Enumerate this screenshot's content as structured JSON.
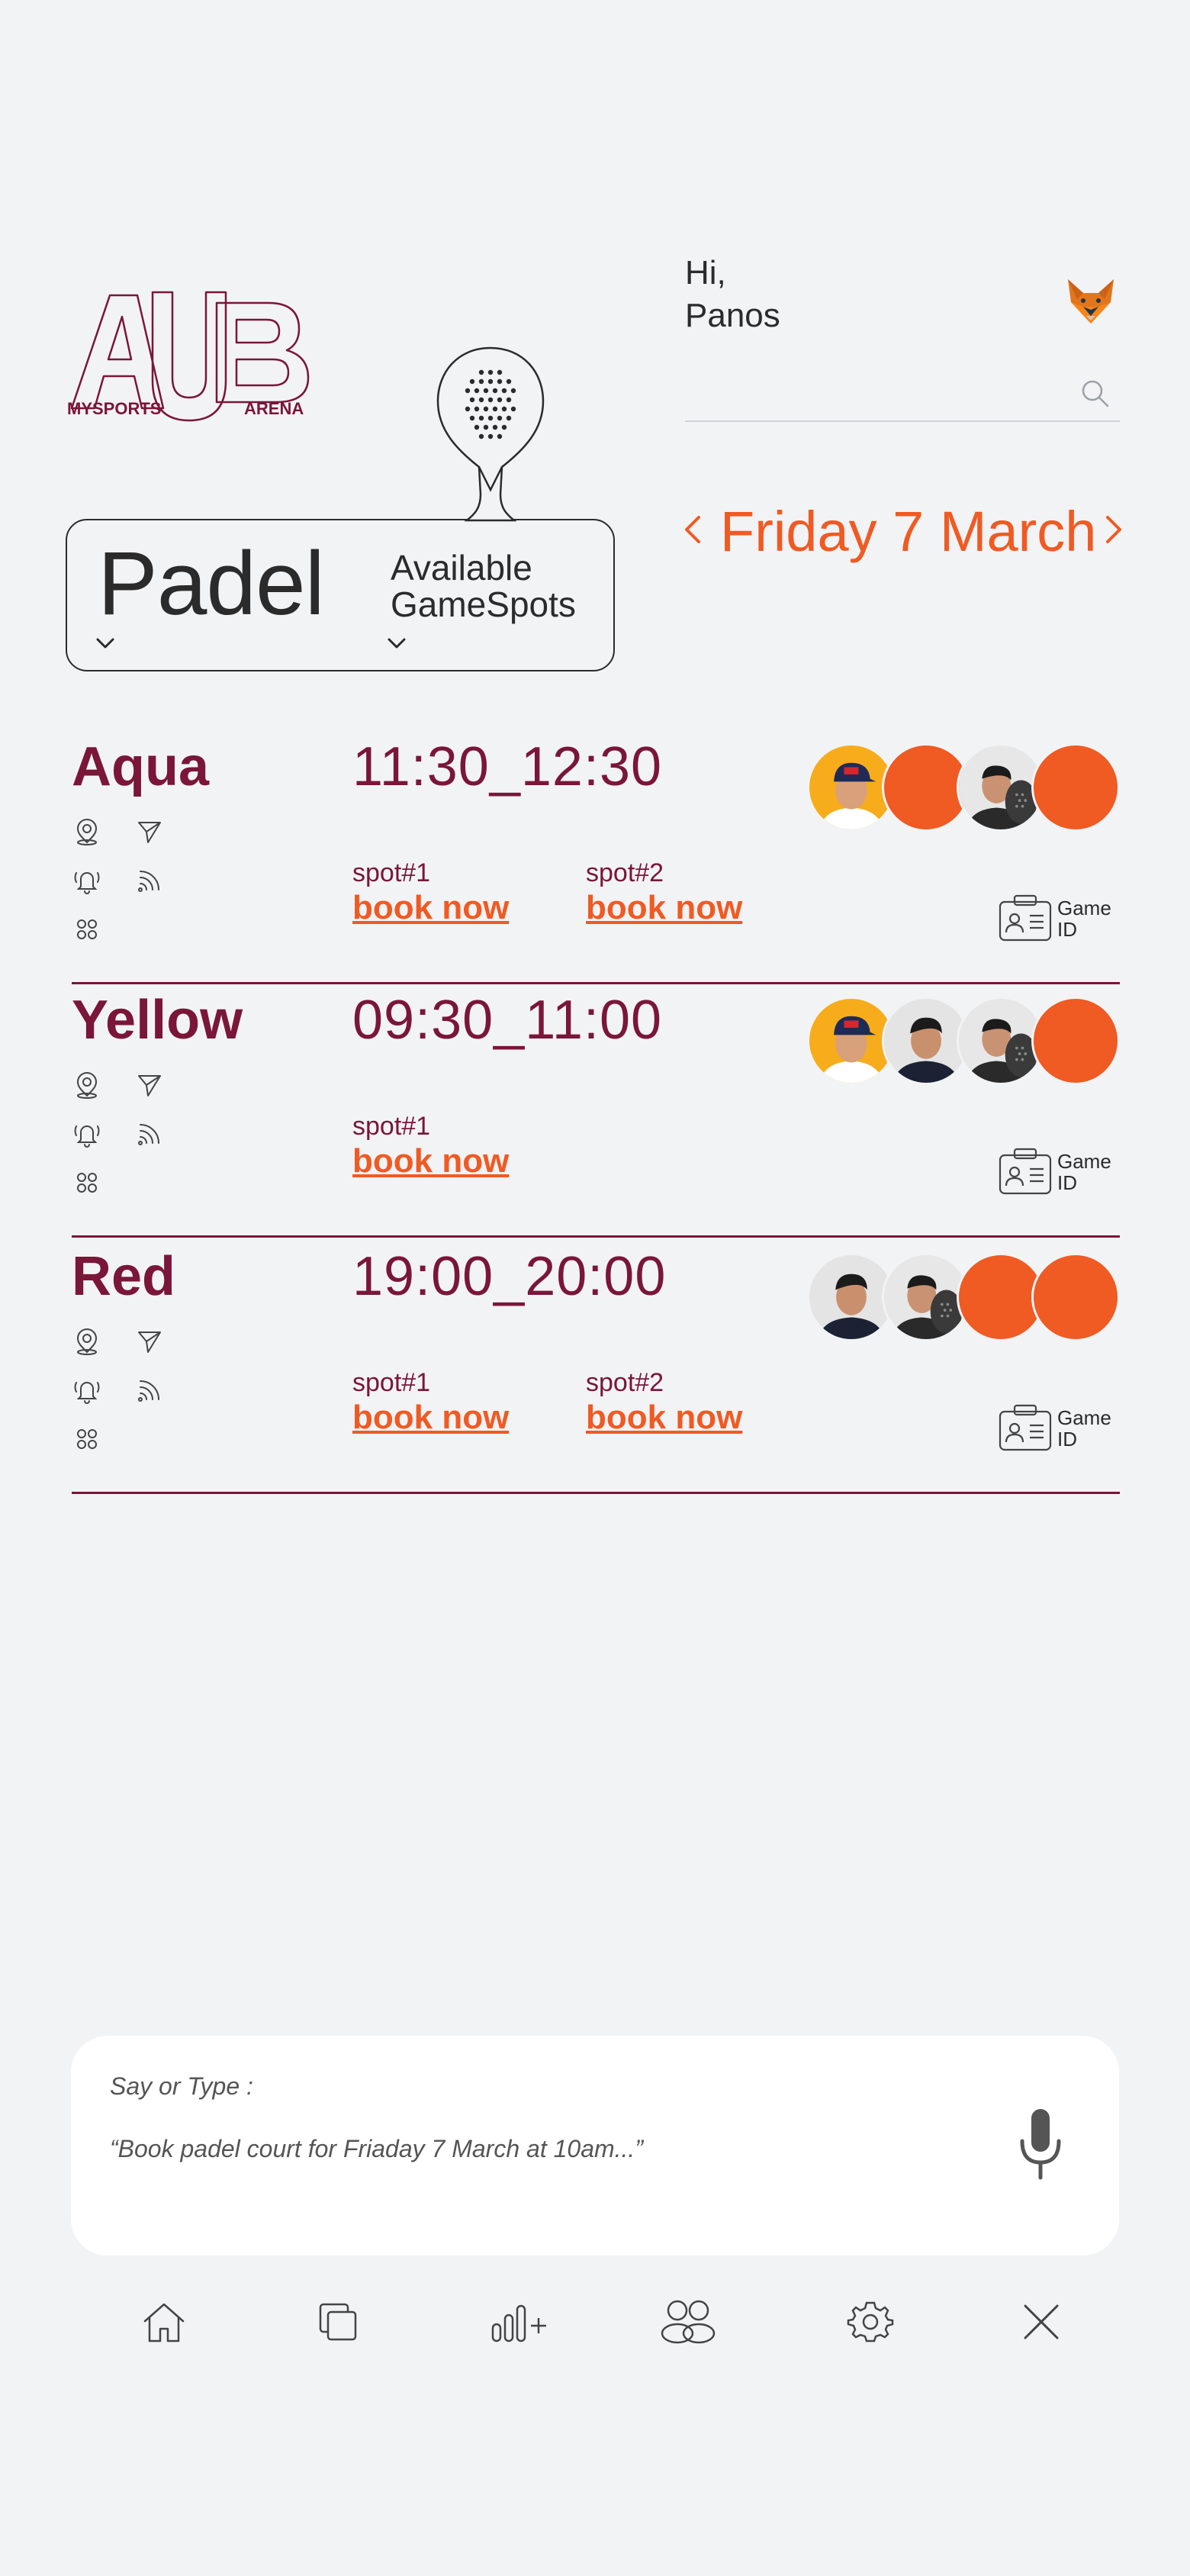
{
  "header": {
    "logo_text": "AUB",
    "logo_left": "MYSPORTS",
    "logo_right": "ARENA",
    "greeting_hi": "Hi,",
    "greeting_name": "Panos",
    "avatar_icon": "fox-icon",
    "search_icon": "search-icon"
  },
  "sport": {
    "name": "Padel",
    "available_line1": "Available",
    "available_line2": "GameSpots"
  },
  "date": {
    "label": "Friday 7 March",
    "prev_icon": "chevron-left-icon",
    "next_icon": "chevron-right-icon"
  },
  "courts": [
    {
      "name": "Aqua",
      "time": "11:30_12:30",
      "spots": [
        {
          "label": "spot#1",
          "action": "book now"
        },
        {
          "label": "spot#2",
          "action": "book now"
        }
      ],
      "players": [
        "player-avatar-cap",
        "open-slot",
        "player-avatar-racket",
        "open-slot"
      ],
      "game_id_line1": "Game",
      "game_id_line2": "ID"
    },
    {
      "name": "Yellow",
      "time": "09:30_11:00",
      "spots": [
        {
          "label": "spot#1",
          "action": "book now"
        }
      ],
      "players": [
        "player-avatar-cap",
        "player-avatar",
        "player-avatar-racket",
        "open-slot"
      ],
      "game_id_line1": "Game",
      "game_id_line2": "ID"
    },
    {
      "name": "Red",
      "time": "19:00_20:00",
      "spots": [
        {
          "label": "spot#1",
          "action": "book now"
        },
        {
          "label": "spot#2",
          "action": "book now"
        }
      ],
      "players": [
        "player-avatar",
        "player-avatar-racket",
        "open-slot",
        "open-slot"
      ],
      "game_id_line1": "Game",
      "game_id_line2": "ID"
    }
  ],
  "prompt": {
    "label": "Say or Type :",
    "text": "“Book padel court for Friaday 7 March at 10am...”",
    "mic_icon": "microphone-icon"
  },
  "nav": [
    "home-icon",
    "copy-icon",
    "stats-add-icon",
    "group-icon",
    "settings-icon",
    "close-icon"
  ],
  "colors": {
    "accent": "#f05a23",
    "brand": "#7a1638",
    "background": "#f2f3f5",
    "avatar_yellow": "#f7ad1b"
  }
}
